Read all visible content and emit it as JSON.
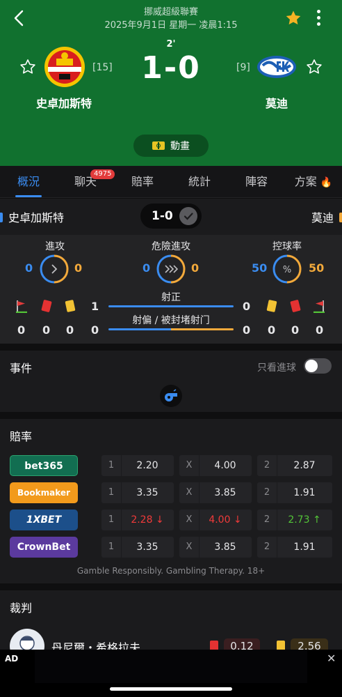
{
  "header": {
    "league": "挪威超級聯賽",
    "datetime": "2025年9月1日 星期一 凌晨1:15",
    "minute": "2'",
    "score": "1-0",
    "home": {
      "name": "史卓加斯特",
      "rank": "[15]"
    },
    "away": {
      "name": "莫迪",
      "rank": "[9]"
    },
    "animation_label": "動畫"
  },
  "tabs": [
    {
      "label": "概況",
      "active": true
    },
    {
      "label": "聊天",
      "badge": "4975"
    },
    {
      "label": "賠率"
    },
    {
      "label": "統計"
    },
    {
      "label": "陣容"
    },
    {
      "label": "方案"
    }
  ],
  "summary": {
    "home": "史卓加斯特",
    "away": "莫迪",
    "score": "1-0",
    "stats": [
      {
        "label": "進攻",
        "home": "0",
        "away": "0"
      },
      {
        "label": "危險進攻",
        "home": "0",
        "away": "0"
      },
      {
        "label": "控球率",
        "home": "50",
        "away": "50"
      }
    ],
    "shots_on_label": "射正",
    "shots_on_home": "1",
    "shots_on_away": "0",
    "shots_off_label": "射偏 / 被封堵射门",
    "shots_off_home": "0",
    "shots_off_away": "0",
    "home_corners": "0",
    "home_red": "0",
    "home_yellow": "0",
    "away_yellow": "0",
    "away_red": "0",
    "away_corners": "0"
  },
  "events": {
    "title": "事件",
    "goals_only_label": "只看進球"
  },
  "odds": {
    "title": "賠率",
    "rows": [
      {
        "brand": "bet365",
        "c1": "2.20",
        "cx": "4.00",
        "c2": "2.87",
        "brand_color": "#126e51"
      },
      {
        "brand": "Bookmaker",
        "c1": "3.35",
        "cx": "3.85",
        "c2": "1.91",
        "brand_color": "#f29a1c"
      },
      {
        "brand": "1XBET",
        "c1": "2.28",
        "cx": "4.00",
        "c2": "2.73",
        "brand_color": "#1c4f8a",
        "c1_trend": "down",
        "cx_trend": "down",
        "c2_trend": "up"
      },
      {
        "brand": "CrownBet",
        "c1": "3.35",
        "cx": "3.85",
        "c2": "1.91",
        "brand_color": "#5b3a9e"
      }
    ],
    "keys": {
      "one": "1",
      "x": "X",
      "two": "2"
    },
    "disclaimer": "Gamble Responsibly. Gambling Therapy. 18+"
  },
  "referee": {
    "title": "裁判",
    "name": "丹尼爾・希格拉夫",
    "red": "0.12",
    "yellow": "2.56"
  },
  "ad": {
    "label": "AD",
    "close": "✕"
  },
  "colors": {
    "header_green": "#11712f",
    "accent_blue": "#3a8cf0",
    "away_orange": "#f2a93b"
  }
}
